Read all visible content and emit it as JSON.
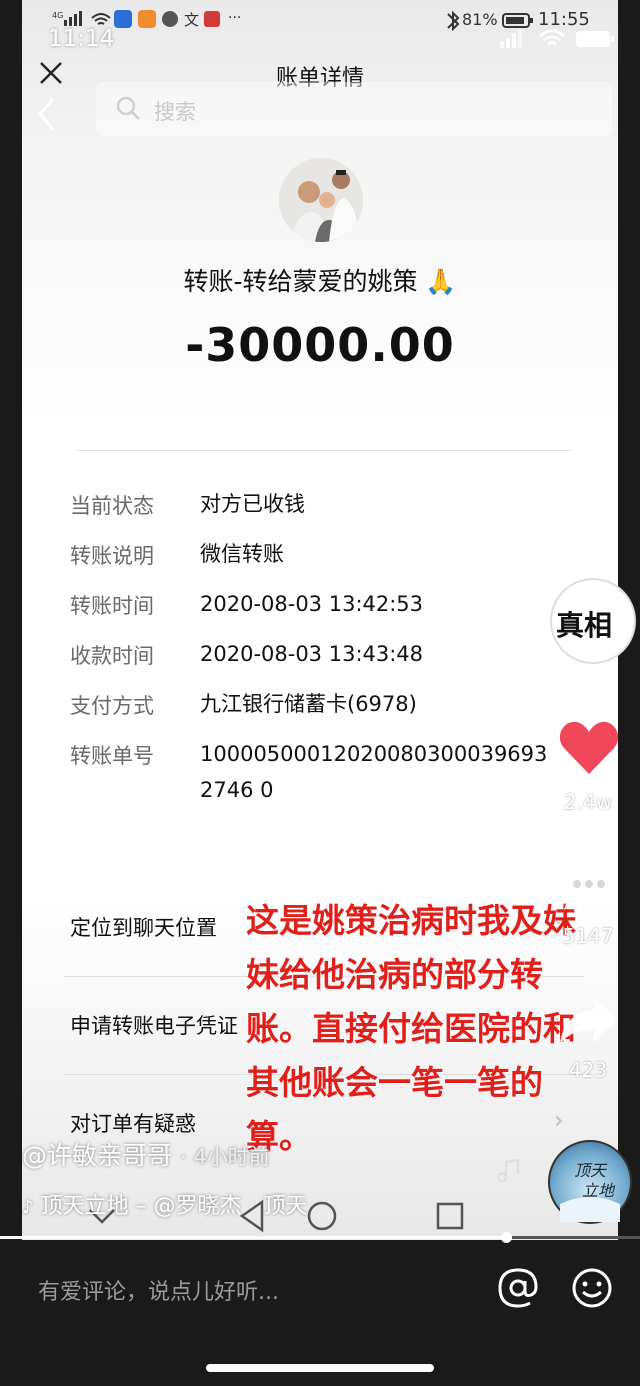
{
  "outer_status": {
    "time": "11:14"
  },
  "inner_status": {
    "battery_pct": "81%",
    "time": "11:55"
  },
  "header": {
    "title": "账单详情"
  },
  "search": {
    "placeholder": "搜索"
  },
  "transfer": {
    "title": "转账-转给蒙爱的姚策",
    "emoji": "🙏",
    "amount": "-30000.00"
  },
  "details": [
    {
      "label": "当前状态",
      "value": "对方已收钱"
    },
    {
      "label": "转账说明",
      "value": "微信转账"
    },
    {
      "label": "转账时间",
      "value": "2020-08-03 13:42:53"
    },
    {
      "label": "收款时间",
      "value": "2020-08-03 13:43:48"
    },
    {
      "label": "支付方式",
      "value": "九江银行储蓄卡(6978)"
    },
    {
      "label": "转账单号",
      "value": "100005000120200803000396932746 0"
    }
  ],
  "actions": [
    {
      "label": "定位到聊天位置"
    },
    {
      "label": "申请转账电子凭证"
    },
    {
      "label": "对订单有疑惑"
    }
  ],
  "overlay_caption": "这是姚策治病时我及妹妹给他治病的部分转账。直接付给医院的和其他账会一笔一笔的算。",
  "sidebar": {
    "creator_badge": "真相",
    "likes": "2.4w",
    "comments": "5147",
    "shares": "423"
  },
  "author": {
    "handle": "@许敏亲哥哥",
    "time": "· 4小时前"
  },
  "music": {
    "text": "顶天立地 – @罗晓杰　顶天"
  },
  "progress": {
    "fraction": 0.79
  },
  "comment_box": {
    "placeholder": "有爱评论，说点儿好听..."
  },
  "colors": {
    "overlay_text": "#e0211b",
    "like_heart": "#f0485a"
  }
}
